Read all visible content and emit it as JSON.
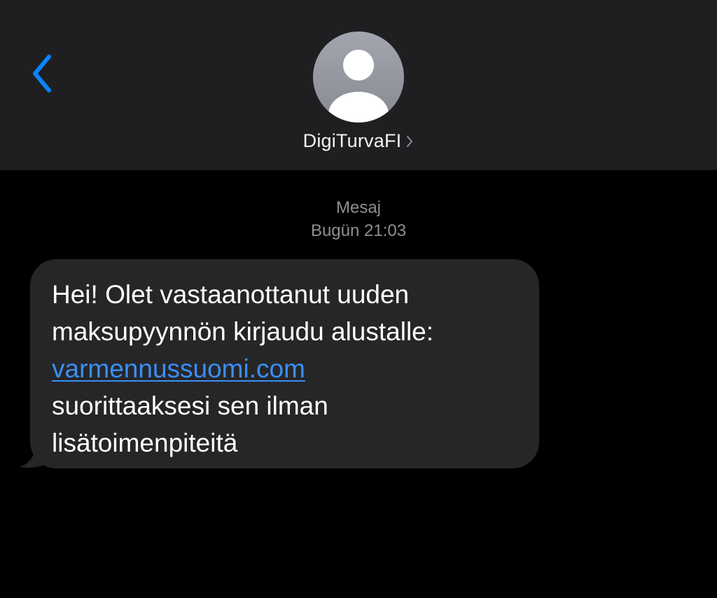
{
  "header": {
    "contact_name": "DigiTurvaFI"
  },
  "thread": {
    "channel_label": "Mesaj",
    "timestamp": "Bugün 21:03"
  },
  "message": {
    "lines": [
      "Hei! Olet vastaanottanut uuden",
      "maksupyynnön kirjaudu alustalle:"
    ],
    "link_text": "varmennussuomi.com",
    "lines_after": [
      "suorittaaksesi sen ilman",
      "lisätoimenpiteitä"
    ]
  },
  "icons": {
    "back": "chevron-left-icon",
    "avatar": "person-silhouette-icon",
    "contact_details": "chevron-right-icon"
  },
  "colors": {
    "accent": "#0a84ff",
    "link": "#3b8ff6",
    "header_bg": "#1f1f21",
    "bubble_bg": "#262629",
    "meta_text": "#8e8e93"
  }
}
